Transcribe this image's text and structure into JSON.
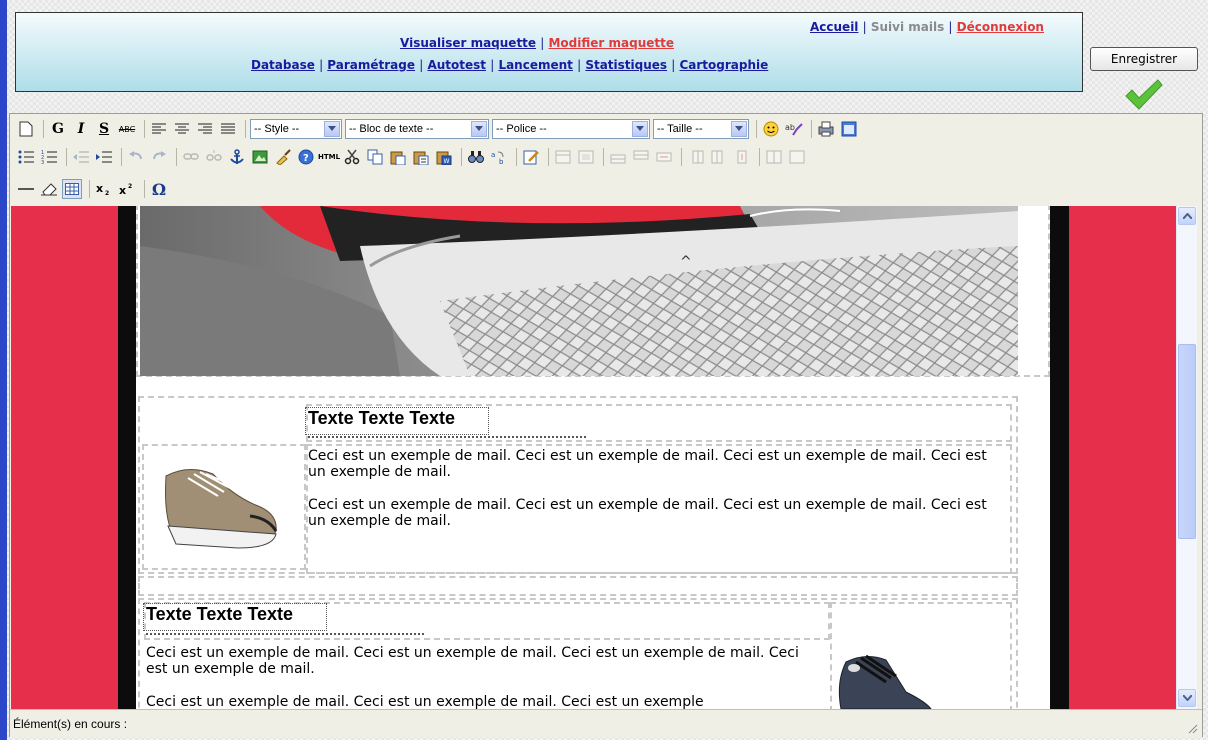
{
  "header": {
    "top_links": {
      "accueil": "Accueil",
      "suivi": "Suivi mails",
      "deconnexion": "Déconnexion",
      "sep": "|"
    },
    "mid_links": {
      "visualiser": "Visualiser maquette",
      "modifier": "Modifier maquette",
      "sep": "|"
    },
    "nav_links": [
      "Database",
      "Paramétrage",
      "Autotest",
      "Lancement",
      "Statistiques",
      "Cartographie"
    ],
    "nav_sep": "|"
  },
  "save_button": "Enregistrer",
  "toolbar": {
    "bold": "G",
    "italic": "I",
    "strike": "S",
    "abc": "ABC",
    "html": "HTML",
    "omega": "Ω",
    "style_select": "-- Style --",
    "bloc_select": "-- Bloc de texte --",
    "police_select": "-- Police --",
    "taille_select": "-- Taille --"
  },
  "content": {
    "block1": {
      "title": "Texte Texte Texte",
      "para1": "Ceci est un exemple de mail. Ceci est un exemple de mail. Ceci est un exemple de mail. Ceci est un exemple de mail.",
      "para2": "Ceci est un exemple de mail. Ceci est un exemple de mail. Ceci est un exemple de mail. Ceci est un exemple de mail."
    },
    "block2": {
      "title": "Texte Texte Texte",
      "para1": "Ceci est un exemple de mail. Ceci est un exemple de mail. Ceci est un exemple de mail. Ceci est un exemple de mail.",
      "para2": "Ceci est un exemple de mail. Ceci est un exemple de mail. Ceci est un exemple"
    }
  },
  "status": {
    "label": "Élément(s) en cours :"
  },
  "colors": {
    "brand_red": "#e52f4b",
    "link_blue": "#1a1aa0",
    "link_red": "#e03a3a",
    "header_gradient_top": "#f4fbfd",
    "header_gradient_bottom": "#aedde8"
  }
}
